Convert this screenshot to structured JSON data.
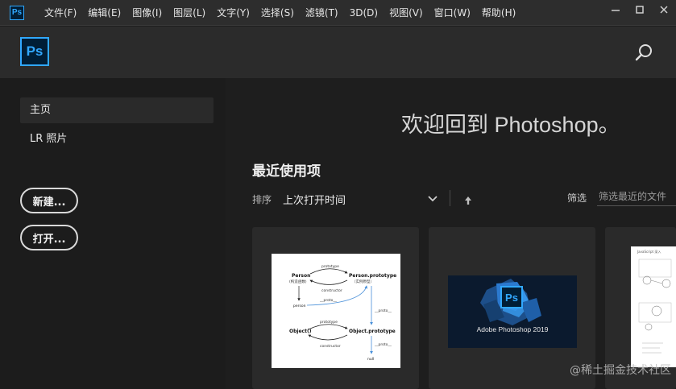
{
  "menubar": {
    "app_icon": "Ps",
    "items": [
      "文件(F)",
      "编辑(E)",
      "图像(I)",
      "图层(L)",
      "文字(Y)",
      "选择(S)",
      "滤镜(T)",
      "3D(D)",
      "视图(V)",
      "窗口(W)",
      "帮助(H)"
    ],
    "window_controls": [
      "minimize-icon",
      "maximize-icon",
      "close-icon"
    ]
  },
  "header": {
    "logo": "Ps",
    "search_icon": "search-icon"
  },
  "sidebar": {
    "items": [
      {
        "label": "主页",
        "active": true
      },
      {
        "label": "LR 照片",
        "active": false
      }
    ],
    "new_button": "新建...",
    "open_button": "打开..."
  },
  "main": {
    "welcome": "欢迎回到 Photoshop。",
    "recent_title": "最近使用项",
    "sort_label": "排序",
    "sort_value": "上次打开时间",
    "filter_label": "筛选",
    "filter_placeholder": "筛选最近的文件"
  },
  "cards": [
    {
      "diagram": {
        "person": "Person",
        "person_sub": "(构造函数)",
        "person_proto": "Person.prototype",
        "person_proto_sub": "（实例原型）",
        "prototype1": "prototype",
        "constructor1": "constructor",
        "instance": "person",
        "proto1": "__proto__",
        "proto2": "__proto__",
        "object": "Object()",
        "object_proto": "Object.prototype",
        "prototype2": "prototype",
        "constructor2": "constructor",
        "proto3": "__proto__",
        "null_label": "null"
      }
    },
    {
      "splash_title": "Adobe Photoshop 2019",
      "splash_logo": "Ps"
    },
    {
      "doc_title": "JavaScript 深入"
    }
  ],
  "watermark": "@稀土掘金技术社区",
  "colors": {
    "accent": "#31a8ff",
    "logo_bg": "#001e36",
    "menubar": "#2d2d2d",
    "header": "#2b2b2b",
    "background": "#1e1e1e"
  }
}
